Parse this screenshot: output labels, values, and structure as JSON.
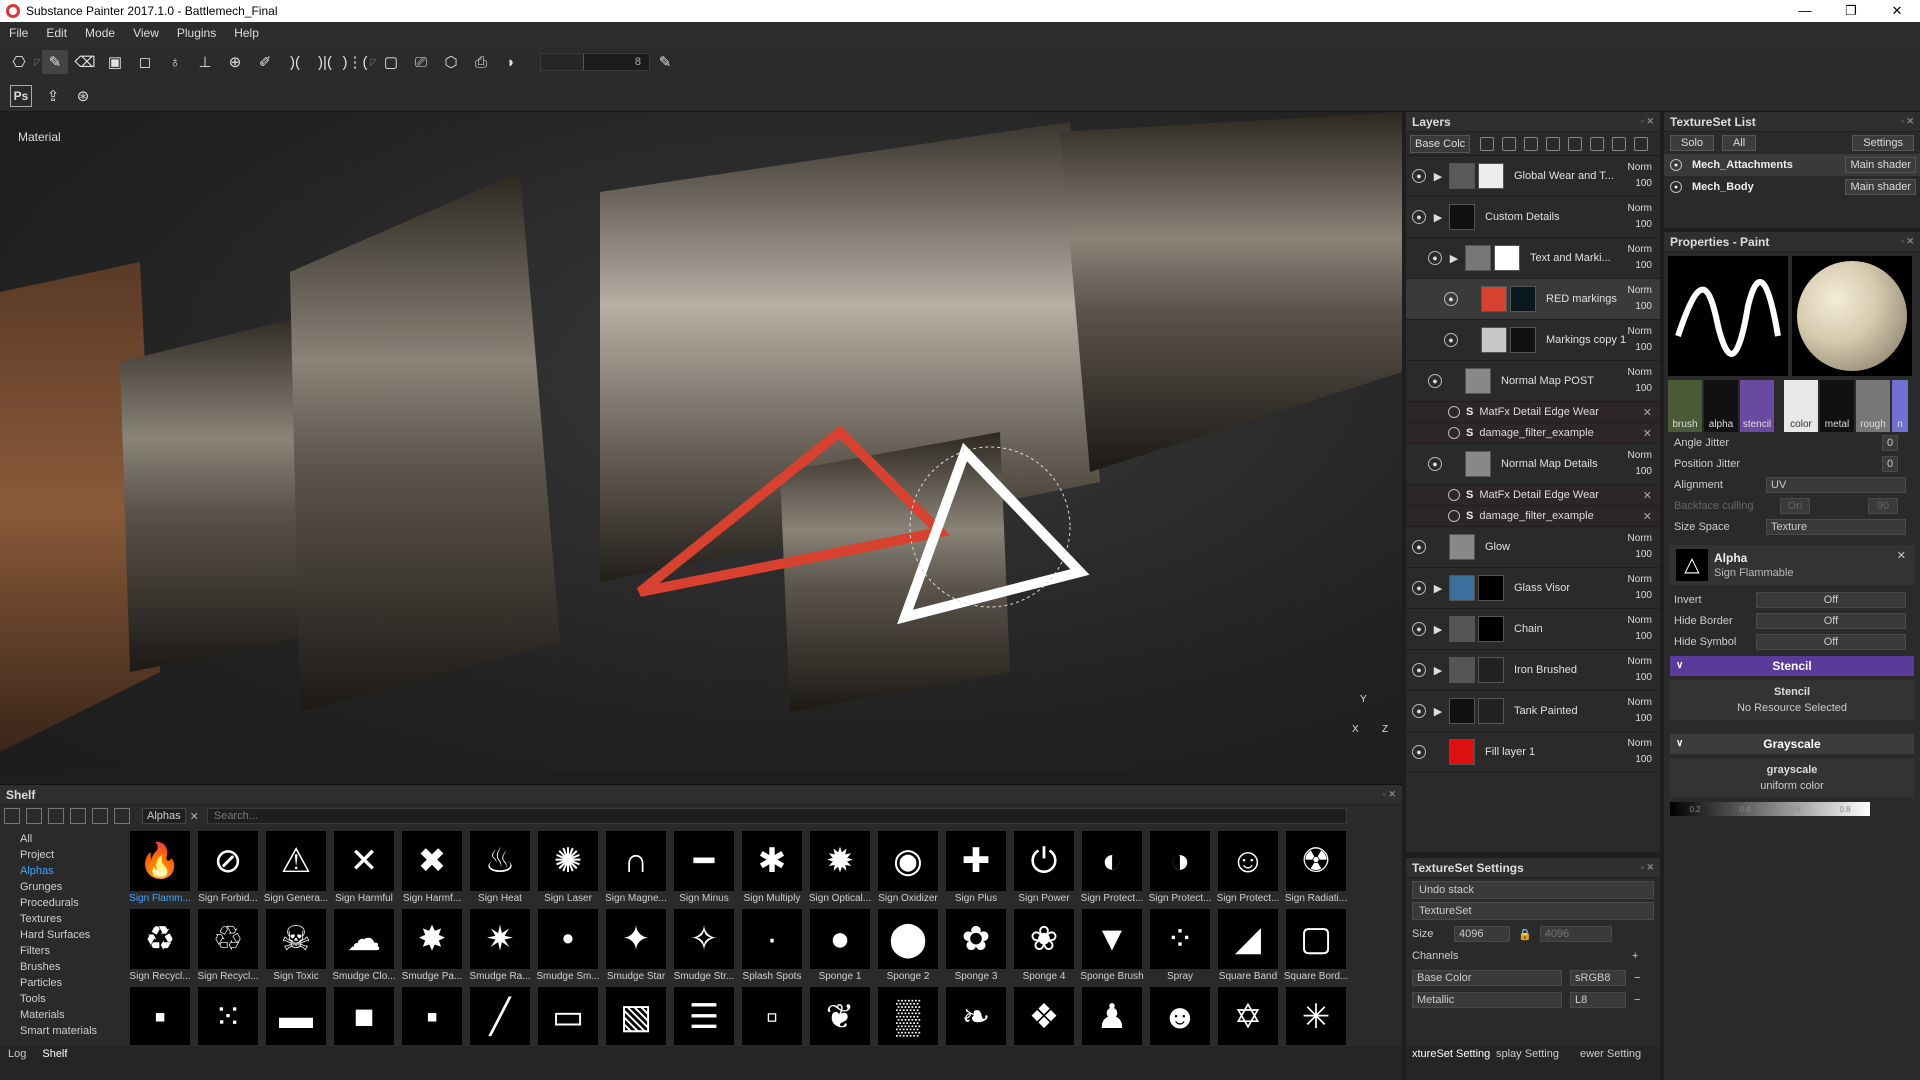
{
  "window": {
    "title": "Substance Painter 2017.1.0 - Battlemech_Final",
    "controls": [
      "—",
      "❐",
      "✕"
    ]
  },
  "menu": [
    "File",
    "Edit",
    "Mode",
    "View",
    "Plugins",
    "Help"
  ],
  "toolbar": {
    "brush_size": "8"
  },
  "viewport": {
    "label": "Material"
  },
  "layers": {
    "title": "Layers",
    "channel": "Base Colc",
    "items": [
      {
        "name": "Global Wear and T...",
        "blend": "Norm",
        "opacity": "100",
        "color": "#5a5a5a",
        "mask": "#eeeeee"
      },
      {
        "name": "Custom Details",
        "blend": "Norm",
        "opacity": "100",
        "color": "#111111",
        "mask": ""
      },
      {
        "name": "Text and Marki...",
        "blend": "Norm",
        "opacity": "100",
        "color": "#777777",
        "mask": "#ffffff"
      },
      {
        "name": "RED markings",
        "blend": "Norm",
        "opacity": "100",
        "color": "#d8412f",
        "mask": "#0b1820"
      },
      {
        "name": "Markings copy 1",
        "blend": "Norm",
        "opacity": "100",
        "color": "#c8c8c8",
        "mask": "#111111"
      },
      {
        "name": "Normal Map POST",
        "blend": "Norm",
        "opacity": "100",
        "color": "#888888",
        "mask": ""
      },
      {
        "name": "Normal Map Details",
        "blend": "Norm",
        "opacity": "100",
        "color": "#888888",
        "mask": ""
      },
      {
        "name": "Glow",
        "blend": "Norm",
        "opacity": "100",
        "color": "#888888",
        "mask": ""
      },
      {
        "name": "Glass Visor",
        "blend": "Norm",
        "opacity": "100",
        "color": "#3d6f9c",
        "mask": "#000000"
      },
      {
        "name": "Chain",
        "blend": "Norm",
        "opacity": "100",
        "color": "#555555",
        "mask": "#000000"
      },
      {
        "name": "Iron Brushed",
        "blend": "Norm",
        "opacity": "100",
        "color": "#555555",
        "mask": "#222222"
      },
      {
        "name": "Tank Painted",
        "blend": "Norm",
        "opacity": "100",
        "color": "#111111",
        "mask": "#222222"
      },
      {
        "name": "Fill layer 1",
        "blend": "Norm",
        "opacity": "100",
        "color": "#e01010",
        "mask": ""
      }
    ],
    "filters": [
      "MatFx Detail Edge Wear",
      "damage_filter_example"
    ]
  },
  "texturesetlist": {
    "title": "TextureSet List",
    "solo": "Solo",
    "all": "All",
    "settings": "Settings",
    "items": [
      {
        "name": "Mech_Attachments",
        "shader": "Main shader"
      },
      {
        "name": "Mech_Body",
        "shader": "Main shader"
      }
    ]
  },
  "properties": {
    "title": "Properties - Paint",
    "mat_labels": [
      "brush",
      "alpha",
      "stencil",
      "color",
      "metal",
      "rough",
      "n"
    ],
    "angle_jitter": "Angle Jitter",
    "angle_jitter_val": "0",
    "position_jitter": "Position Jitter",
    "position_jitter_val": "0",
    "alignment": "Alignment",
    "alignment_val": "UV",
    "backface": "Backface culling",
    "backface_val": "On",
    "backface_num": "90",
    "size_space": "Size Space",
    "size_space_val": "Texture",
    "alpha_title": "Alpha",
    "alpha_name": "Sign Flammable",
    "invert": "Invert",
    "invert_val": "Off",
    "hide_border": "Hide Border",
    "hide_border_val": "Off",
    "hide_symbol": "Hide Symbol",
    "hide_symbol_val": "Off",
    "stencil_section": "Stencil",
    "stencil_sub": "Stencil",
    "stencil_none": "No Resource Selected",
    "grayscale_section": "Grayscale",
    "grayscale_sub": "grayscale",
    "grayscale_desc": "uniform color",
    "grayscale_ticks": [
      "0.2",
      "0.4",
      "0.6",
      "0.8"
    ]
  },
  "tsettings": {
    "title": "TextureSet Settings",
    "undo": "Undo stack",
    "textureset": "TextureSet",
    "size_label": "Size",
    "size_val": "4096",
    "size_val2": "4096",
    "channels": "Channels",
    "base_color": "Base Color",
    "base_color_fmt": "sRGB8",
    "metallic": "Metallic",
    "metallic_fmt": "L8"
  },
  "bottom_tabs": [
    "xtureSet Setting",
    "splay Setting",
    "ewer Setting"
  ],
  "shelf": {
    "title": "Shelf",
    "filter": "Alphas",
    "search_placeholder": "Search...",
    "categories": [
      "All",
      "Project",
      "Alphas",
      "Grunges",
      "Procedurals",
      "Textures",
      "Hard Surfaces",
      "Filters",
      "Brushes",
      "Particles",
      "Tools",
      "Materials",
      "Smart materials"
    ],
    "row1": [
      {
        "label": "Sign Flamm...",
        "glyph": "🔥"
      },
      {
        "label": "Sign Forbid...",
        "glyph": "⊘"
      },
      {
        "label": "Sign Genera...",
        "glyph": "⚠"
      },
      {
        "label": "Sign Harmful",
        "glyph": "✕"
      },
      {
        "label": "Sign Harmf...",
        "glyph": "✖"
      },
      {
        "label": "Sign Heat",
        "glyph": "♨"
      },
      {
        "label": "Sign Laser",
        "glyph": "✺"
      },
      {
        "label": "Sign Magne...",
        "glyph": "∩"
      },
      {
        "label": "Sign Minus",
        "glyph": "━"
      },
      {
        "label": "Sign Multiply",
        "glyph": "✱"
      },
      {
        "label": "Sign Optical...",
        "glyph": "✹"
      },
      {
        "label": "Sign Oxidizer",
        "glyph": "◉"
      },
      {
        "label": "Sign Plus",
        "glyph": "✚"
      },
      {
        "label": "Sign Power",
        "glyph": "⏻"
      },
      {
        "label": "Sign Protect...",
        "glyph": "◐"
      },
      {
        "label": "Sign Protect...",
        "glyph": "◑"
      },
      {
        "label": "Sign Protect...",
        "glyph": "☺"
      },
      {
        "label": "Sign Radiati...",
        "glyph": "☢"
      }
    ],
    "row2": [
      {
        "label": "Sign Recycl...",
        "glyph": "♻"
      },
      {
        "label": "Sign Recycl...",
        "glyph": "♲"
      },
      {
        "label": "Sign Toxic",
        "glyph": "☠"
      },
      {
        "label": "Smudge Clo...",
        "glyph": "☁"
      },
      {
        "label": "Smudge Pa...",
        "glyph": "✸"
      },
      {
        "label": "Smudge Ra...",
        "glyph": "✷"
      },
      {
        "label": "Smudge Sm...",
        "glyph": "•"
      },
      {
        "label": "Smudge Star",
        "glyph": "✦"
      },
      {
        "label": "Smudge Str...",
        "glyph": "✧"
      },
      {
        "label": "Splash Spots",
        "glyph": "·"
      },
      {
        "label": "Sponge 1",
        "glyph": "●"
      },
      {
        "label": "Sponge 2",
        "glyph": "⬤"
      },
      {
        "label": "Sponge 3",
        "glyph": "✿"
      },
      {
        "label": "Sponge 4",
        "glyph": "❀"
      },
      {
        "label": "Sponge Brush",
        "glyph": "▼"
      },
      {
        "label": "Spray",
        "glyph": "⁘"
      },
      {
        "label": "Square Band",
        "glyph": "◢"
      },
      {
        "label": "Square Bord...",
        "glyph": "▢"
      }
    ],
    "row3": [
      "▪",
      "⁙",
      "▬",
      "■",
      "▪",
      "╱",
      "▭",
      "▧",
      "☰",
      "▫",
      "❦",
      "▒",
      "❧",
      "❖",
      "♟",
      "☻",
      "✡",
      "✳"
    ]
  },
  "statusbar": [
    "Log",
    "Shelf"
  ]
}
